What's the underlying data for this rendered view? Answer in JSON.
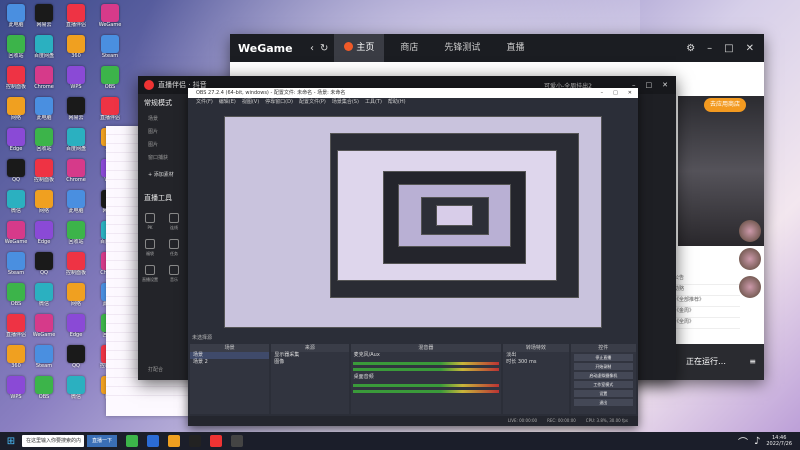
{
  "wegame": {
    "logo": "WeGame",
    "tabs": [
      {
        "label": "主页",
        "active": true
      },
      {
        "label": "商店",
        "active": false
      },
      {
        "label": "先锋测试",
        "active": false
      },
      {
        "label": "直播",
        "active": false
      }
    ],
    "hot_button": "去应用商店",
    "news_items": [
      "公告",
      "助赂",
      "《全部推荐》",
      "《金周》",
      "《全周》"
    ],
    "running_label": "正在运行…"
  },
  "stream_app": {
    "title": "直播伴侣 · 抖音",
    "user": "可爱小-全周挂出2",
    "sidebar": {
      "mode_label": "常规模式",
      "scene_label": "场景",
      "items": [
        "图片",
        "图片",
        "窗口捕获"
      ],
      "add_source": "+ 添加素材",
      "tools_label": "直播工具",
      "tools": [
        "PK",
        "连线",
        "福袋",
        "任务",
        "直播设置",
        "音乐"
      ],
      "bottom_label": "打配合"
    }
  },
  "obs": {
    "title": "OBS 27.2.4 (64-bit, windows) - 配置文件: 未命名 - 场景: 未命名",
    "menu": [
      "文件(F)",
      "编辑(E)",
      "视图(V)",
      "停靠窗口(D)",
      "配置文件(P)",
      "场景集合(S)",
      "工具(T)",
      "帮助(H)"
    ],
    "dock_header": "未选择源",
    "docks": {
      "scenes": {
        "header": "场景",
        "items": [
          "场景",
          "场景 2"
        ]
      },
      "sources": {
        "header": "来源",
        "items": [
          "显示器采集",
          "图像"
        ]
      },
      "mixer": {
        "header": "混音器",
        "channels": [
          "麦克风/Aux",
          "桌面音频"
        ]
      },
      "transitions": {
        "header": "转场特效",
        "type": "淡出",
        "duration_label": "时长",
        "duration": "300 ms"
      },
      "controls": {
        "header": "控件",
        "buttons": [
          "停止直播",
          "开始录制",
          "启动虚拟摄像机",
          "工作室模式",
          "设置",
          "退出"
        ]
      }
    },
    "status": [
      "LIVE: 00:00:00",
      "REC: 00:00:00",
      "CPU: 3.8%, 30.00 fps"
    ]
  },
  "taskbar": {
    "search_placeholder": "在这里输入你要搜索的内容",
    "active_app": "直播一下",
    "time": "14:46",
    "date": "2022/7/26"
  },
  "desktop_icons": [
    "此电脑",
    "回收站",
    "控制面板",
    "网络",
    "Edge",
    "QQ",
    "微信",
    "WeGame",
    "Steam",
    "OBS",
    "直播伴侣",
    "360",
    "WPS",
    "网易云",
    "百度网盘",
    "Chrome"
  ]
}
